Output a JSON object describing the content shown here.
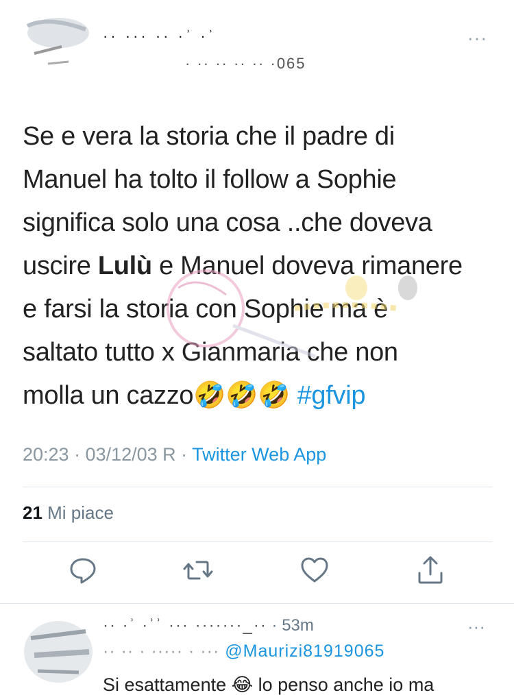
{
  "tweet": {
    "author_name": "·· ··· ·· ·ʾ ·ʾ",
    "author_handle": "· ·· ·· ·· ·· ·065",
    "more": "···",
    "text": {
      "line1": "Se e vera la storia che il padre di",
      "line2": "Manuel ha tolto il follow a Sophie",
      "line3": "significa solo una cosa ..che doveva",
      "line4_pre": "uscire ",
      "line4_bold": "Lulù",
      "line4_post": " e Manuel doveva rimanere",
      "line5": "e farsi la storia con Sophie ma è",
      "line6": "saltato tutto x Gianmaria che non",
      "line7_pre": "molla un cazzo",
      "line7_emoji": "🤣🤣🤣",
      "line7_hashtag": "#gfvip"
    },
    "timestamp": "20:23 · 03/12/03 R · ",
    "source": "Twitter Web App",
    "likes_count": "21",
    "likes_label": " Mi piace"
  },
  "actions": {
    "icons": [
      "reply-icon",
      "retweet-icon",
      "like-icon",
      "share-icon"
    ]
  },
  "reply": {
    "name": "·· ·ʾ ·ʾʾ ··· ·······_··",
    "time": " · 53m",
    "handle_prefix": "·· ·· · ····· · ··· ",
    "handle": "@Maurizi81919065",
    "more": "···",
    "text": "Si esattamente 😂 lo penso anche io ma"
  },
  "colors": {
    "link": "#1b95e0",
    "meta_gray": "#8a96a0",
    "divider": "#e1e8ed"
  }
}
